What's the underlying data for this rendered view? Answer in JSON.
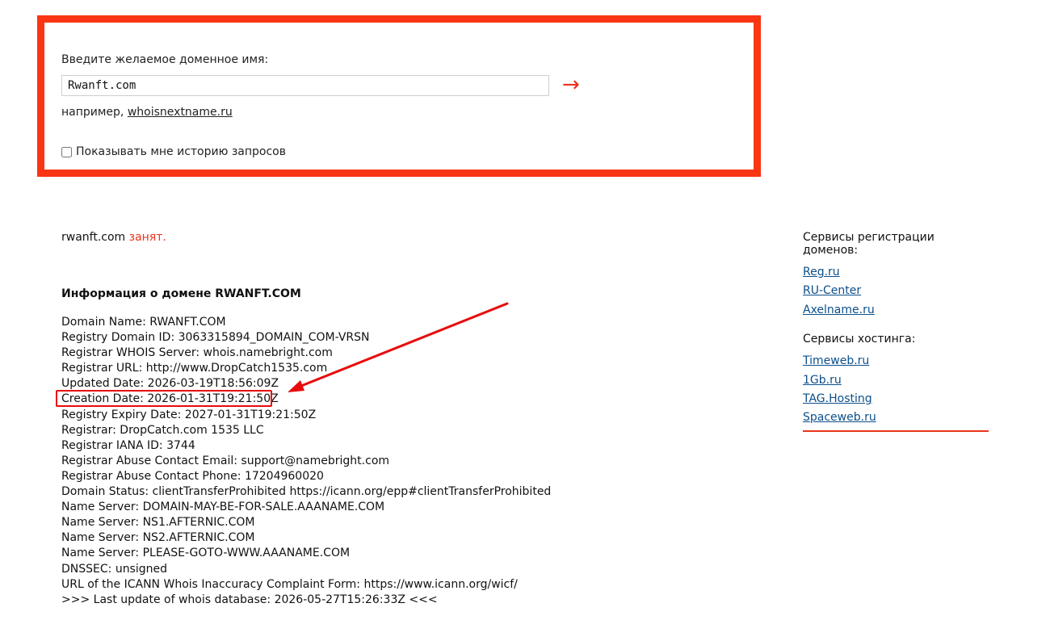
{
  "search": {
    "label": "Введите желаемое доменное имя:",
    "input_value": "Rwanft.com",
    "submit_arrow": "→",
    "example_prefix": "например,",
    "example_link": "whoisnextname.ru",
    "history_label": "Показывать мне историю запросов",
    "history_checked": false
  },
  "result": {
    "domain": "rwanft.com",
    "status": "занят."
  },
  "whois": {
    "title": "Информация о домене RWANFT.COM",
    "lines": [
      "Domain Name: RWANFT.COM",
      "Registry Domain ID: 3063315894_DOMAIN_COM-VRSN",
      "Registrar WHOIS Server: whois.namebright.com",
      "Registrar URL: http://www.DropCatch1535.com",
      "Updated Date: 2026-03-19T18:56:09Z",
      "Creation Date: 2026-01-31T19:21:50Z",
      "Registry Expiry Date: 2027-01-31T19:21:50Z",
      "Registrar: DropCatch.com 1535 LLC",
      "Registrar IANA ID: 3744",
      "Registrar Abuse Contact Email: support@namebright.com",
      "Registrar Abuse Contact Phone: 17204960020",
      "Domain Status: clientTransferProhibited https://icann.org/epp#clientTransferProhibited",
      "Name Server: DOMAIN-MAY-BE-FOR-SALE.AAANAME.COM",
      "Name Server: NS1.AFTERNIC.COM",
      "Name Server: NS2.AFTERNIC.COM",
      "Name Server: PLEASE-GOTO-WWW.AAANAME.COM",
      "DNSSEC: unsigned",
      "URL of the ICANN Whois Inaccuracy Complaint Form: https://www.icann.org/wicf/",
      ">>> Last update of whois database: 2026-05-27T15:26:33Z <<<"
    ]
  },
  "sidebar": {
    "registrars_title": "Сервисы регистрации доменов:",
    "registrars": [
      "Reg.ru",
      "RU-Center",
      "Axelname.ru"
    ],
    "hosting_title": "Сервисы хостинга:",
    "hosting": [
      "Timeweb.ru",
      "1Gb.ru",
      "TAG.Hosting",
      "Spaceweb.ru"
    ]
  },
  "colors": {
    "accent": "#fa3614",
    "annotation": "#e80b0b",
    "link": "#0b4f8a"
  }
}
